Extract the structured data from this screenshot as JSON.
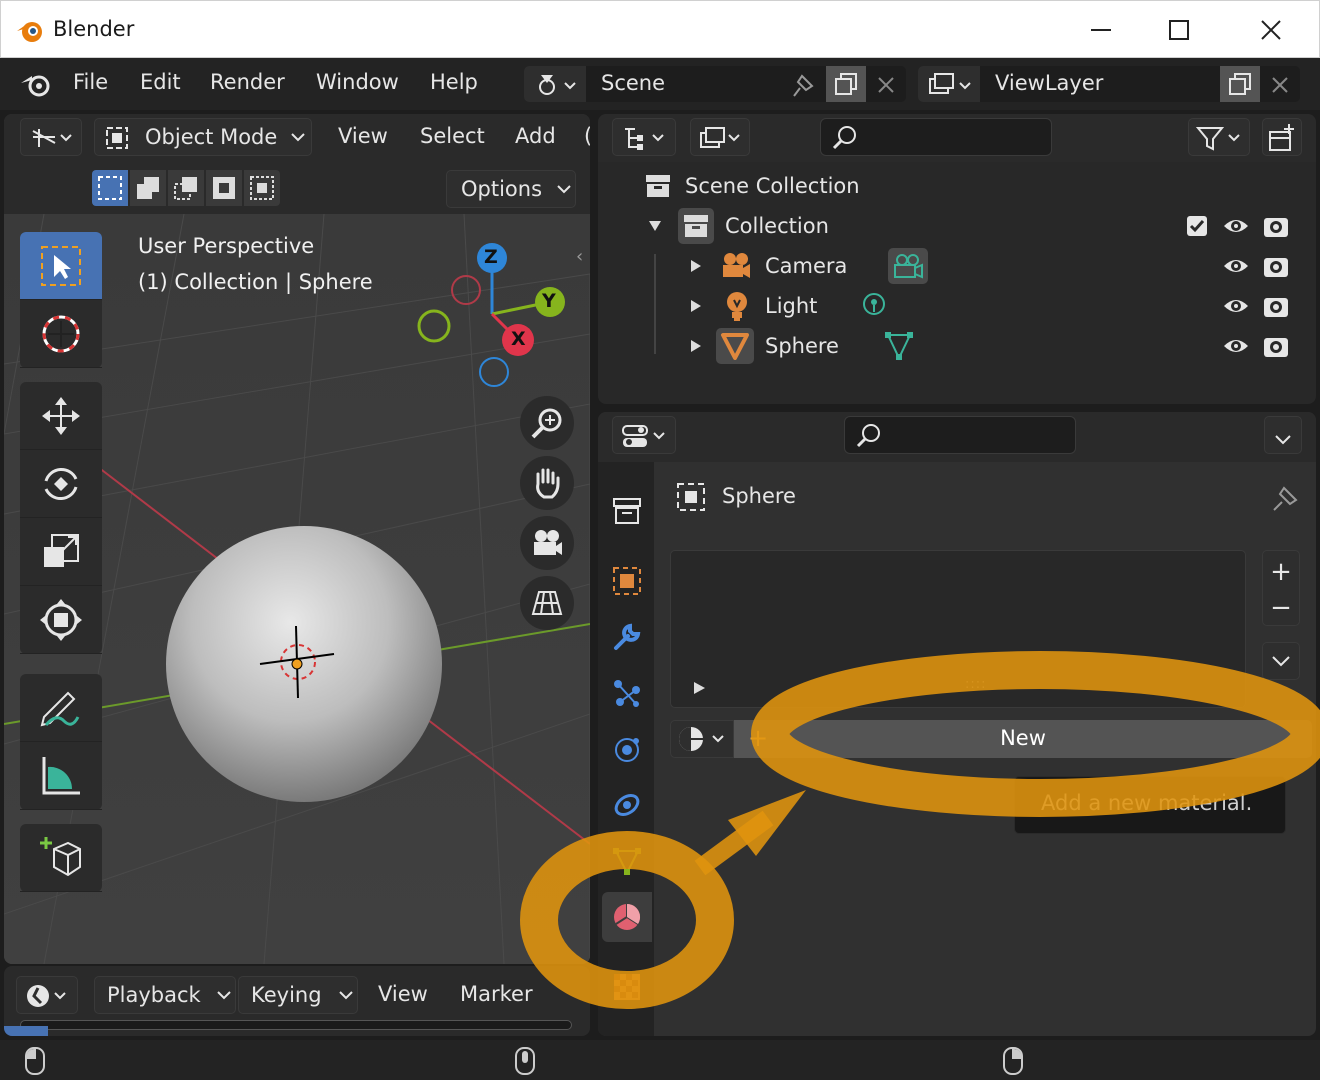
{
  "window": {
    "title": "Blender"
  },
  "menu": {
    "file": "File",
    "edit": "Edit",
    "render": "Render",
    "window": "Window",
    "help": "Help"
  },
  "scene": {
    "name": "Scene"
  },
  "view_layer": {
    "name": "ViewLayer"
  },
  "viewport": {
    "mode": "Object Mode",
    "menus": {
      "view": "View",
      "select": "Select",
      "add": "Add",
      "cut": "("
    },
    "options": "Options",
    "perspective": "User Perspective",
    "context": "(1) Collection | Sphere",
    "gizmo": {
      "z": "Z",
      "y": "Y",
      "x": "X"
    }
  },
  "timeline": {
    "playback": "Playback",
    "keying": "Keying",
    "view": "View",
    "marker": "Marker"
  },
  "outliner": {
    "root": "Scene Collection",
    "collection": "Collection",
    "items": [
      {
        "label": "Camera"
      },
      {
        "label": "Light"
      },
      {
        "label": "Sphere"
      }
    ]
  },
  "properties": {
    "object_name": "Sphere",
    "new_button": "New",
    "new_plus": "+",
    "tooltip": "Add a new material.",
    "list_handle": "::::",
    "plus": "+",
    "minus": "−"
  },
  "colors": {
    "accent": "#4772b3",
    "annotation": "#e0940e",
    "axis_x": "#e0354b",
    "axis_y": "#86b41d",
    "axis_z": "#2e86d8"
  }
}
